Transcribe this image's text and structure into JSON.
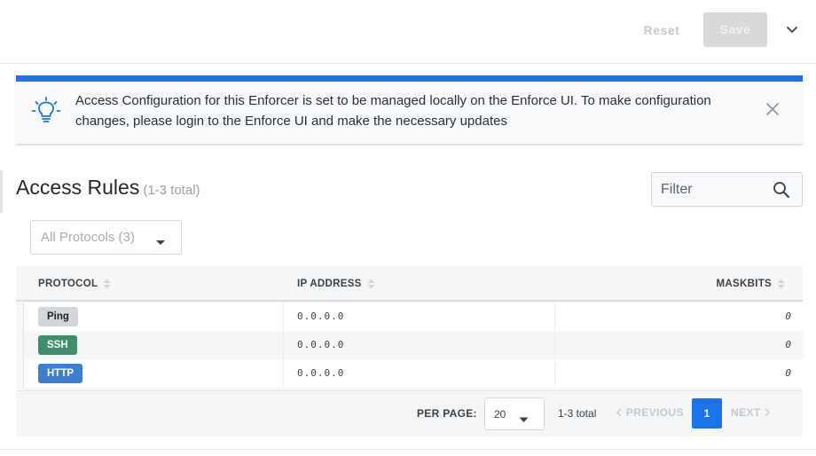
{
  "toolbar": {
    "reset_label": "Reset",
    "save_label": "Save",
    "more_icon": "chevron-down-icon"
  },
  "banner": {
    "icon": "lightbulb-icon",
    "message": "Access Configuration for this Enforcer is set to be managed locally on the Enforce UI. To make configuration changes, please login to the Enforce UI and make the necessary updates",
    "close_icon": "close-icon",
    "accent_color": "#1a73e8"
  },
  "section": {
    "title": "Access Rules",
    "count": "(1-3 total)"
  },
  "filter": {
    "placeholder": "Filter",
    "icon": "search-icon"
  },
  "protocol_filter": {
    "selected": "All Protocols (3)"
  },
  "table": {
    "columns": {
      "protocol": "PROTOCOL",
      "ip_address": "IP ADDRESS",
      "maskbits": "MASKBITS"
    },
    "rows": [
      {
        "protocol": "Ping",
        "ip": "0.0.0.0",
        "maskbits": "0",
        "badge_bg": "#d3d6da",
        "badge_fg": "#222222"
      },
      {
        "protocol": "SSH",
        "ip": "0.0.0.0",
        "maskbits": "0",
        "badge_bg": "#3f8f6e",
        "badge_fg": "#ffffff"
      },
      {
        "protocol": "HTTP",
        "ip": "0.0.0.0",
        "maskbits": "0",
        "badge_bg": "#3d7fcf",
        "badge_fg": "#ffffff"
      }
    ]
  },
  "pagination": {
    "per_page_label": "PER PAGE:",
    "per_page_value": "20",
    "total": "1-3 total",
    "previous": "PREVIOUS",
    "current_page": "1",
    "next": "NEXT"
  }
}
